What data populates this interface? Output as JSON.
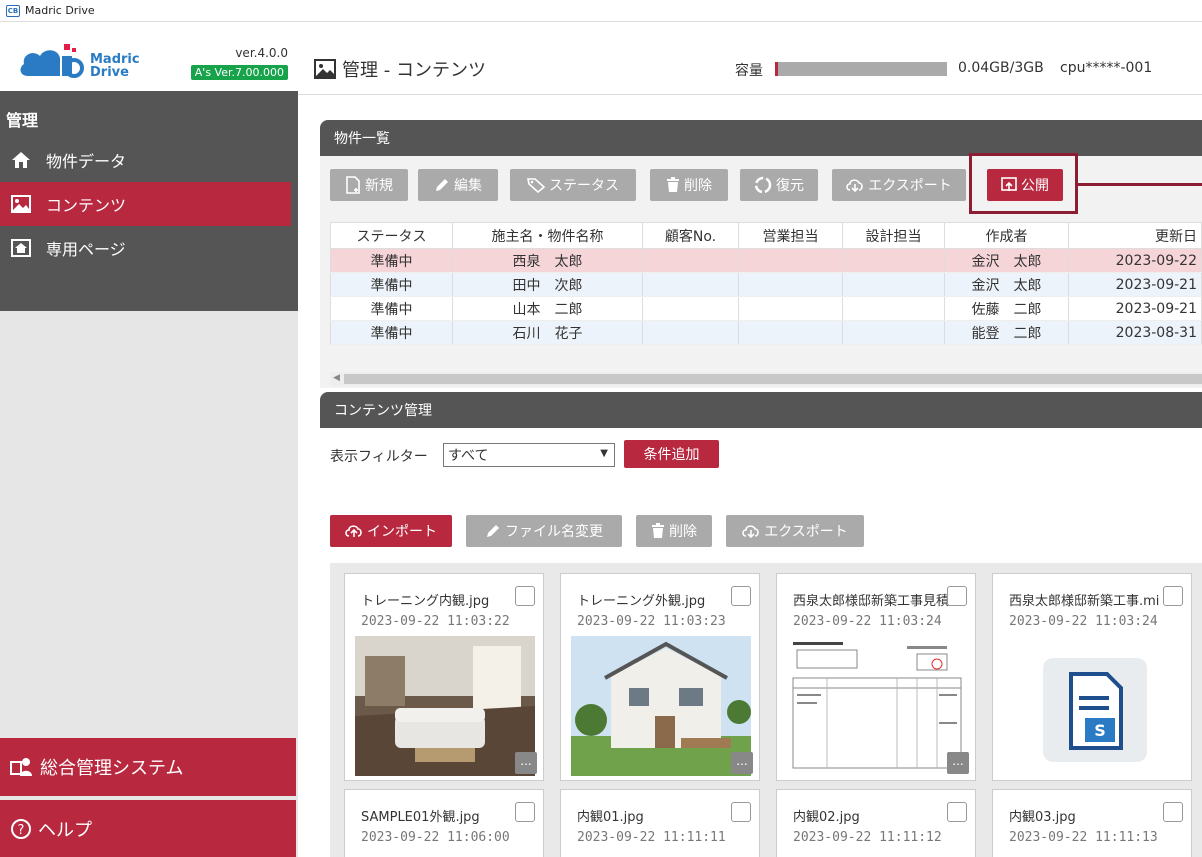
{
  "window": {
    "title": "Madric Drive"
  },
  "logo": {
    "line1": "Madric",
    "line2": "Drive",
    "version": "ver.4.0.0",
    "as_version": "A's Ver.7.00.000"
  },
  "nav": {
    "heading": "管理",
    "items": [
      {
        "label": "物件データ",
        "icon": "home-icon"
      },
      {
        "label": "コンテンツ",
        "icon": "image-icon",
        "active": true
      },
      {
        "label": "専用ページ",
        "icon": "house-page-icon"
      }
    ]
  },
  "bottom": {
    "system_label": "総合管理システム",
    "help_label": "ヘルプ"
  },
  "header": {
    "title": "管理 - コンテンツ",
    "capacity_label": "容量",
    "capacity_text": "0.04GB/3GB",
    "cpu": "cpu*****-001"
  },
  "properties": {
    "title": "物件一覧",
    "toolbar": {
      "new": "新規",
      "edit": "編集",
      "status": "ステータス",
      "delete": "削除",
      "restore": "復元",
      "export": "エクスポート",
      "publish": "公開"
    },
    "columns": [
      "ステータス",
      "施主名・物件名称",
      "顧客No.",
      "営業担当",
      "設計担当",
      "作成者",
      "更新日"
    ],
    "rows": [
      {
        "status": "準備中",
        "name": "西泉　太郎",
        "customer": "",
        "sales": "",
        "design": "",
        "creator": "金沢　太郎",
        "updated": "2023-09-22"
      },
      {
        "status": "準備中",
        "name": "田中　次郎",
        "customer": "",
        "sales": "",
        "design": "",
        "creator": "金沢　太郎",
        "updated": "2023-09-21"
      },
      {
        "status": "準備中",
        "name": "山本　二郎",
        "customer": "",
        "sales": "",
        "design": "",
        "creator": "佐藤　二郎",
        "updated": "2023-09-21"
      },
      {
        "status": "準備中",
        "name": "石川　花子",
        "customer": "",
        "sales": "",
        "design": "",
        "creator": "能登　二郎",
        "updated": "2023-08-31"
      }
    ]
  },
  "contents": {
    "title": "コンテンツ管理",
    "filter_label": "表示フィルター",
    "filter_value": "すべて",
    "add_condition": "条件追加",
    "toolbar": {
      "import": "インポート",
      "rename": "ファイル名変更",
      "delete": "削除",
      "export": "エクスポート"
    },
    "files": [
      {
        "name": "トレーニング内観.jpg",
        "date": "2023-09-22 11:03:22"
      },
      {
        "name": "トレーニング外観.jpg",
        "date": "2023-09-22 11:03:23"
      },
      {
        "name": "西泉太郎様邸新築工事見積",
        "date": "2023-09-22 11:03:24"
      },
      {
        "name": "西泉太郎様邸新築工事.mi",
        "date": "2023-09-22 11:03:24"
      },
      {
        "name": "SAMPLE01外観.jpg",
        "date": "2023-09-22 11:06:00"
      },
      {
        "name": "内観01.jpg",
        "date": "2023-09-22 11:11:11"
      },
      {
        "name": "内観02.jpg",
        "date": "2023-09-22 11:11:12"
      },
      {
        "name": "内観03.jpg",
        "date": "2023-09-22 11:11:13"
      }
    ],
    "more_label": "..."
  },
  "colors": {
    "accent": "#b8283f",
    "sidebar": "#555555",
    "button_gray": "#aaaaaa",
    "selected_row": "#f6d5d9"
  }
}
